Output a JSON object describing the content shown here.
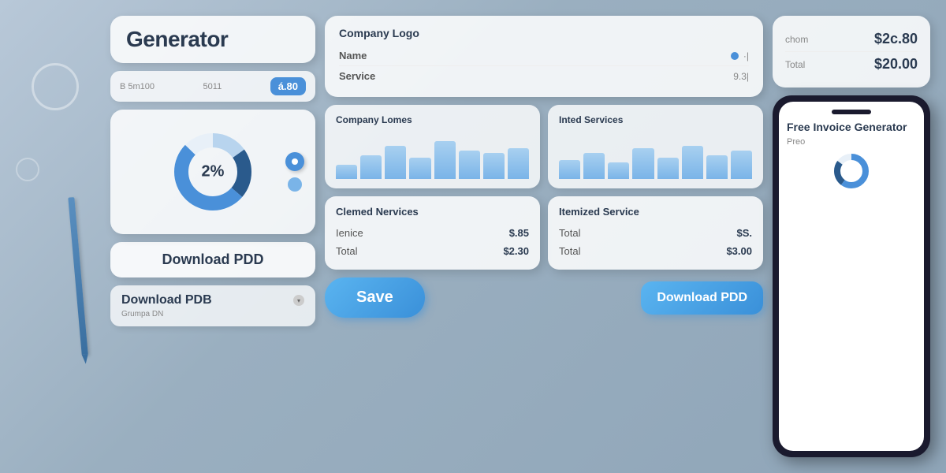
{
  "app": {
    "title": "Generator",
    "subtitle": "Free Invoice Generator"
  },
  "header": {
    "input_label": "B 5m100",
    "input_sub": "5011",
    "value_badge": "á.80"
  },
  "donut": {
    "center_value": "2%",
    "segments": [
      {
        "percent": 60,
        "color": "#4a90d9"
      },
      {
        "percent": 25,
        "color": "#2a5a8c"
      },
      {
        "percent": 15,
        "color": "#b8d4ee"
      }
    ]
  },
  "downloads": {
    "primary_label": "Download PDD",
    "secondary_label": "Download PDB",
    "sub_text": "Grumpa DN"
  },
  "form": {
    "title": "Company Logo",
    "fields": [
      {
        "label": "Name",
        "value": "·|"
      },
      {
        "label": "Service",
        "value": "9.3|"
      }
    ]
  },
  "charts": {
    "left": {
      "title": "Company Lomes",
      "bars": [
        30,
        50,
        70,
        45,
        80,
        60,
        55,
        65
      ]
    },
    "right": {
      "title": "Inted Services",
      "bars": [
        40,
        55,
        35,
        65,
        45,
        70,
        50,
        60
      ]
    }
  },
  "claimed_services": {
    "title": "Clemed Nervices",
    "rows": [
      {
        "label": "Ienice",
        "value": "$.85"
      },
      {
        "label": "Total",
        "value": "$2.30"
      }
    ]
  },
  "itemized_services": {
    "title": "Itemized Service",
    "rows": [
      {
        "label": "Total",
        "value": "$S."
      },
      {
        "label": "Total",
        "value": "$3.00"
      }
    ]
  },
  "prices": {
    "rows": [
      {
        "label": "chom",
        "value": "$2c.80"
      },
      {
        "label": "Total",
        "value": "$20.00"
      }
    ]
  },
  "buttons": {
    "save": "Save",
    "download_pdf": "Download PDD"
  },
  "phone": {
    "title": "Free Invoice Generator",
    "subtitle": "Preo"
  },
  "colors": {
    "primary_blue": "#4a90d9",
    "dark_blue": "#2a3a50",
    "light_blue": "#7ab4e8",
    "bg_gradient_start": "#b8c8d8",
    "bg_gradient_end": "#8fa5b8"
  }
}
